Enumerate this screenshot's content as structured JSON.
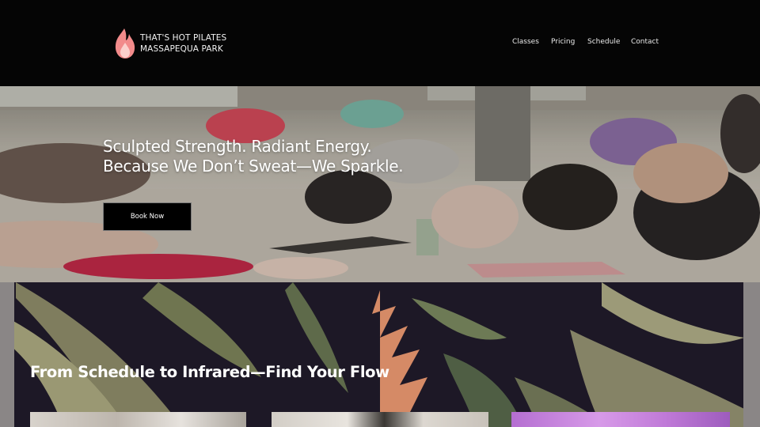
{
  "brand": {
    "line1": "THAT'S HOT PILATES",
    "line2": "MASSAPEQUA PARK",
    "logo_icon": "flame-icon",
    "logo_color": "#f28b8b"
  },
  "nav": {
    "items": [
      {
        "label": "Classes"
      },
      {
        "label": "Pricing"
      },
      {
        "label": "Schedule"
      },
      {
        "label": "Contact"
      }
    ]
  },
  "hero": {
    "heading_line1": "Sculpted Strength. Radiant Energy.",
    "heading_line2": "Because We Don’t Sweat—We Sparkle.",
    "cta_label": "Book Now"
  },
  "section2": {
    "title": "From Schedule to Infrared—Find Your Flow"
  },
  "colors": {
    "header_bg": "#050505",
    "button_bg": "#000000",
    "section_bg": "#1b1721"
  }
}
